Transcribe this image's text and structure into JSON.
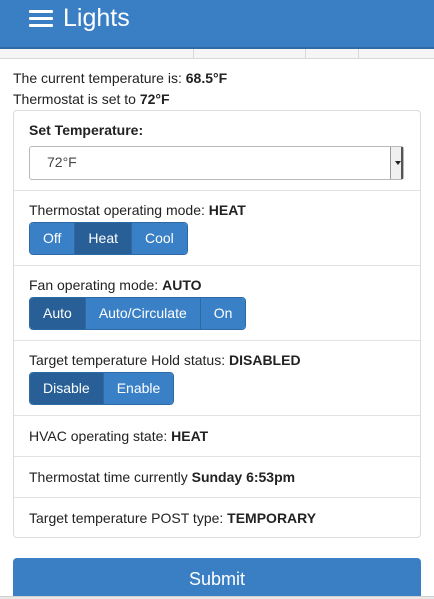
{
  "header": {
    "title": "Lights",
    "menu_icon": "hamburger-menu-icon",
    "bar_color": "#3a7fc4"
  },
  "status": {
    "current_temp_label": "The current temperature is:",
    "current_temp_value": "68.5°F",
    "setpoint_label": "Thermostat is set to",
    "setpoint_value": "72°F"
  },
  "set_temperature": {
    "label": "Set Temperature:",
    "selected": "72°F"
  },
  "thermostat_mode": {
    "label": "Thermostat operating mode:",
    "value": "HEAT",
    "options": [
      "Off",
      "Heat",
      "Cool"
    ],
    "active": "Heat"
  },
  "fan_mode": {
    "label": "Fan operating mode:",
    "value": "AUTO",
    "options": [
      "Auto",
      "Auto/Circulate",
      "On"
    ],
    "active": "Auto"
  },
  "hold_status": {
    "label": "Target temperature Hold status:",
    "value": "DISABLED",
    "options": [
      "Disable",
      "Enable"
    ],
    "active": "Disable"
  },
  "hvac_state": {
    "label": "HVAC operating state:",
    "value": "HEAT"
  },
  "thermostat_time": {
    "label": "Thermostat time currently",
    "value": "Sunday 6:53pm"
  },
  "post_type": {
    "label": "Target temperature POST type:",
    "value": "TEMPORARY"
  },
  "submit": {
    "label": "Submit"
  },
  "colors": {
    "accent": "#3a7fc4",
    "button": "#3a80c6",
    "button_active": "#275f96"
  }
}
